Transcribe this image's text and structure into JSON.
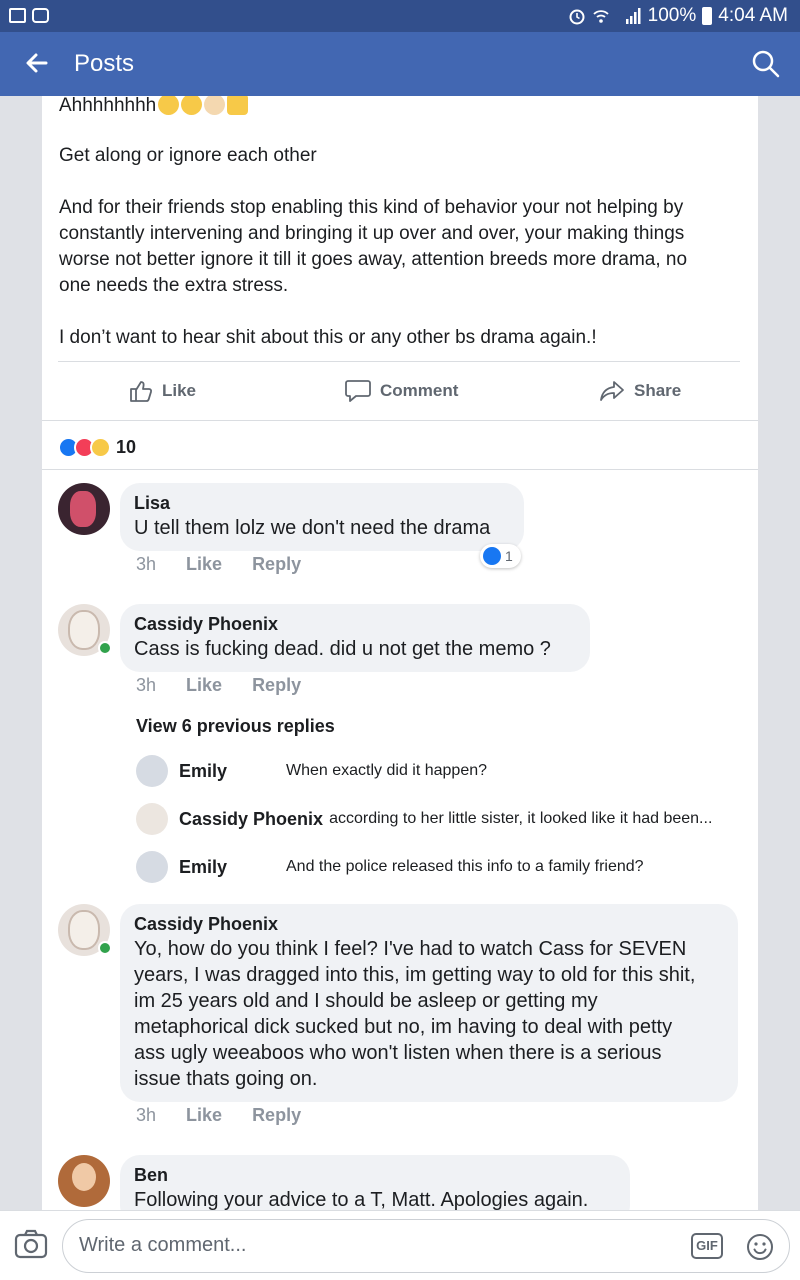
{
  "status_bar": {
    "battery": "100%",
    "time": "4:04 AM"
  },
  "nav": {
    "title": "Posts"
  },
  "post": {
    "lines": [
      "Ahhhhhhhh",
      "Get along or ignore each other",
      "And for their friends stop enabling this kind of behavior your not helping by",
      "constantly intervening and bringing it up over and over, your making things",
      "worse not better ignore it till it goes away, attention breeds more drama, no",
      "one needs the extra stress.",
      "I don’t want to hear shit about this or any other bs drama again.!"
    ],
    "actions": {
      "like": "Like",
      "comment": "Comment",
      "share": "Share"
    },
    "reaction_count": "10"
  },
  "comments": [
    {
      "name": "Lisa",
      "text": [
        "U tell them lolz we don't need the drama"
      ],
      "time": "3h",
      "like": "Like",
      "reply": "Reply",
      "likes": "1"
    },
    {
      "name": "Cassidy Phoenix",
      "text": [
        "Cass is fucking dead. did u not get the memo ?"
      ],
      "time": "3h",
      "like": "Like",
      "reply": "Reply"
    },
    {
      "name": "Cassidy Phoenix",
      "text": [
        "Yo, how do you think I feel? I've had to watch Cass for SEVEN",
        "years, I was dragged into this, im getting way to old for this shit,",
        "im 25 years old and I should be asleep or getting my",
        "metaphorical dick sucked but no, im having to deal with petty",
        "ass ugly weeaboos who won't listen when there is a serious",
        "issue thats going on."
      ],
      "time": "3h",
      "like": "Like",
      "reply": "Reply"
    },
    {
      "name": "Ben",
      "text": [
        "Following your advice to a T, Matt. Apologies again."
      ]
    }
  ],
  "replies": {
    "view_previous": "View 6 previous replies",
    "items": [
      {
        "name": "Emily",
        "text": "When exactly did it happen?"
      },
      {
        "name": "Cassidy Phoenix",
        "text": "according to her little sister, it looked like it had been..."
      },
      {
        "name": "Emily",
        "text": "And the police released this info to a family friend?"
      }
    ]
  },
  "composer": {
    "placeholder": "Write a comment...",
    "gif": "GIF"
  },
  "colors": {
    "nav": "#4267b2",
    "status": "#324f8c",
    "like_blue": "#1877f2",
    "love_red": "#f33e58",
    "online_green": "#31a24c"
  }
}
